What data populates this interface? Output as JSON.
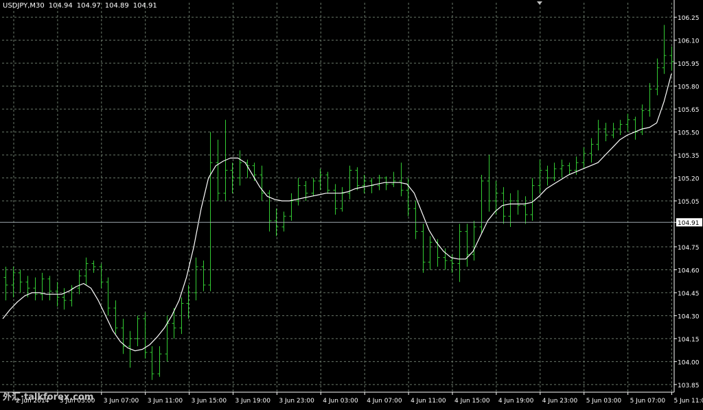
{
  "header": {
    "symbol": "USDJPY,M30",
    "open": "104.94",
    "high": "104.97",
    "low": "104.89",
    "close": "104.91"
  },
  "current_price_label": "104.91",
  "watermark": "外汇·talkforex.com",
  "colors": {
    "background": "#000000",
    "bars": "#33cc33",
    "ma_line": "#ffffff",
    "grid": "#6b7a6b",
    "axis_text": "#ffffff",
    "price_line": "#a0a8b0"
  },
  "chart_data": {
    "type": "line",
    "title": "USDJPY,M30",
    "xlabel": "",
    "ylabel": "",
    "ylim": [
      103.8,
      106.3
    ],
    "grid": true,
    "y_ticks": [
      "106.25",
      "106.10",
      "105.95",
      "105.80",
      "105.65",
      "105.50",
      "105.35",
      "105.20",
      "105.05",
      "104.91",
      "104.75",
      "104.60",
      "104.45",
      "104.30",
      "104.15",
      "104.00",
      "103.85"
    ],
    "x_tick_labels": [
      "2 Jun 2014",
      "3 Jun 03:00",
      "3 Jun 07:00",
      "3 Jun 11:00",
      "3 Jun 15:00",
      "3 Jun 19:00",
      "3 Jun 23:00",
      "4 Jun 03:00",
      "4 Jun 07:00",
      "4 Jun 11:00",
      "4 Jun 15:00",
      "4 Jun 19:00",
      "4 Jun 23:00",
      "5 Jun 03:00",
      "5 Jun 07:00",
      "5 Jun 11:00"
    ],
    "current_price": 104.91,
    "series": [
      {
        "kind": "ohlc",
        "values": [
          [
            104.55,
            104.62,
            104.4,
            104.5
          ],
          [
            104.5,
            104.62,
            104.42,
            104.58
          ],
          [
            104.58,
            104.6,
            104.45,
            104.52
          ],
          [
            104.52,
            104.56,
            104.42,
            104.48
          ],
          [
            104.48,
            104.55,
            104.4,
            104.44
          ],
          [
            104.44,
            104.58,
            104.4,
            104.54
          ],
          [
            104.54,
            104.56,
            104.4,
            104.46
          ],
          [
            104.46,
            104.52,
            104.36,
            104.42
          ],
          [
            104.42,
            104.48,
            104.34,
            104.4
          ],
          [
            104.4,
            104.5,
            104.36,
            104.48
          ],
          [
            104.48,
            104.6,
            104.44,
            104.56
          ],
          [
            104.56,
            104.68,
            104.5,
            104.64
          ],
          [
            104.64,
            104.66,
            104.58,
            104.62
          ],
          [
            104.62,
            104.64,
            104.48,
            104.52
          ],
          [
            104.52,
            104.55,
            104.3,
            104.35
          ],
          [
            104.35,
            104.4,
            104.18,
            104.22
          ],
          [
            104.22,
            104.28,
            104.05,
            104.1
          ],
          [
            104.1,
            104.2,
            103.96,
            104.15
          ],
          [
            104.15,
            104.3,
            104.1,
            104.28
          ],
          [
            104.28,
            104.32,
            104.02,
            104.06
          ],
          [
            104.06,
            104.1,
            103.88,
            103.92
          ],
          [
            103.92,
            104.1,
            103.9,
            104.05
          ],
          [
            104.05,
            104.3,
            104.0,
            104.25
          ],
          [
            104.25,
            104.35,
            104.15,
            104.22
          ],
          [
            104.22,
            104.42,
            104.18,
            104.38
          ],
          [
            104.38,
            104.5,
            104.28,
            104.45
          ],
          [
            104.45,
            104.68,
            104.4,
            104.62
          ],
          [
            104.62,
            104.66,
            104.46,
            104.5
          ],
          [
            104.5,
            105.5,
            104.46,
            105.3
          ],
          [
            105.3,
            105.45,
            105.05,
            105.1
          ],
          [
            105.1,
            105.58,
            105.05,
            105.25
          ],
          [
            105.25,
            105.3,
            105.1,
            105.2
          ],
          [
            105.2,
            105.38,
            105.15,
            105.3
          ],
          [
            105.3,
            105.32,
            105.2,
            105.28
          ],
          [
            105.28,
            105.3,
            105.18,
            105.22
          ],
          [
            105.22,
            105.28,
            105.05,
            105.1
          ],
          [
            105.1,
            105.12,
            104.85,
            104.92
          ],
          [
            104.92,
            105.0,
            104.82,
            104.88
          ],
          [
            104.88,
            104.98,
            104.85,
            104.95
          ],
          [
            104.95,
            105.1,
            104.92,
            105.05
          ],
          [
            105.05,
            105.2,
            105.02,
            105.15
          ],
          [
            105.15,
            105.18,
            105.05,
            105.1
          ],
          [
            105.1,
            105.2,
            105.08,
            105.18
          ],
          [
            105.18,
            105.26,
            105.12,
            105.22
          ],
          [
            105.22,
            105.24,
            105.1,
            105.12
          ],
          [
            105.12,
            105.16,
            104.96,
            105.0
          ],
          [
            105.0,
            105.14,
            104.98,
            105.1
          ],
          [
            105.1,
            105.28,
            105.06,
            105.25
          ],
          [
            105.25,
            105.27,
            105.12,
            105.15
          ],
          [
            105.15,
            105.22,
            105.1,
            105.18
          ],
          [
            105.18,
            105.2,
            105.1,
            105.15
          ],
          [
            105.15,
            105.22,
            105.12,
            105.2
          ],
          [
            105.2,
            105.21,
            105.12,
            105.16
          ],
          [
            105.16,
            105.24,
            105.14,
            105.18
          ],
          [
            105.18,
            105.3,
            105.08,
            105.12
          ],
          [
            105.12,
            105.2,
            104.95,
            105.0
          ],
          [
            105.0,
            105.05,
            104.8,
            104.85
          ],
          [
            104.85,
            104.9,
            104.58,
            104.65
          ],
          [
            104.65,
            104.82,
            104.6,
            104.78
          ],
          [
            104.78,
            104.8,
            104.62,
            104.68
          ],
          [
            104.68,
            104.74,
            104.6,
            104.66
          ],
          [
            104.66,
            104.7,
            104.58,
            104.64
          ],
          [
            104.64,
            104.9,
            104.52,
            104.85
          ],
          [
            104.85,
            104.9,
            104.62,
            104.7
          ],
          [
            104.7,
            104.92,
            104.66,
            104.88
          ],
          [
            104.88,
            105.22,
            104.84,
            105.18
          ],
          [
            105.18,
            105.35,
            104.98,
            105.05
          ],
          [
            105.05,
            105.18,
            104.96,
            105.1
          ],
          [
            105.1,
            105.14,
            104.9,
            104.95
          ],
          [
            104.95,
            105.1,
            104.88,
            105.05
          ],
          [
            105.05,
            105.12,
            104.96,
            105.02
          ],
          [
            105.02,
            105.08,
            104.9,
            104.96
          ],
          [
            104.96,
            105.2,
            104.92,
            105.15
          ],
          [
            105.15,
            105.32,
            105.1,
            105.25
          ],
          [
            105.25,
            105.28,
            105.15,
            105.2
          ],
          [
            105.2,
            105.3,
            105.18,
            105.26
          ],
          [
            105.26,
            105.32,
            105.2,
            105.28
          ],
          [
            105.28,
            105.3,
            105.22,
            105.25
          ],
          [
            105.25,
            105.34,
            105.22,
            105.3
          ],
          [
            105.3,
            105.4,
            105.26,
            105.36
          ],
          [
            105.36,
            105.46,
            105.3,
            105.42
          ],
          [
            105.42,
            105.58,
            105.38,
            105.52
          ],
          [
            105.52,
            105.56,
            105.44,
            105.48
          ],
          [
            105.48,
            105.56,
            105.46,
            105.52
          ],
          [
            105.52,
            105.58,
            105.48,
            105.55
          ],
          [
            105.55,
            105.62,
            105.5,
            105.58
          ],
          [
            105.58,
            105.6,
            105.45,
            105.5
          ],
          [
            105.5,
            105.68,
            105.48,
            105.64
          ],
          [
            105.64,
            105.82,
            105.6,
            105.78
          ],
          [
            105.78,
            105.98,
            105.74,
            105.92
          ],
          [
            105.92,
            106.2,
            105.88,
            106.0
          ],
          [
            106.0,
            106.06,
            105.9,
            105.96
          ]
        ]
      },
      {
        "name": "",
        "kind": "moving-average",
        "values": [
          104.28,
          104.34,
          104.39,
          104.43,
          104.45,
          104.45,
          104.44,
          104.44,
          104.44,
          104.46,
          104.49,
          104.51,
          104.48,
          104.4,
          104.3,
          104.2,
          104.13,
          104.09,
          104.07,
          104.08,
          104.11,
          104.16,
          104.22,
          104.3,
          104.4,
          104.55,
          104.75,
          105.0,
          105.2,
          105.28,
          105.31,
          105.33,
          105.33,
          105.3,
          105.22,
          105.14,
          105.08,
          105.06,
          105.05,
          105.05,
          105.06,
          105.07,
          105.08,
          105.09,
          105.1,
          105.1,
          105.1,
          105.11,
          105.13,
          105.14,
          105.15,
          105.16,
          105.17,
          105.17,
          105.17,
          105.16,
          105.1,
          104.98,
          104.86,
          104.78,
          104.72,
          104.68,
          104.67,
          104.67,
          104.72,
          104.82,
          104.92,
          104.98,
          105.02,
          105.03,
          105.03,
          105.03,
          105.04,
          105.08,
          105.13,
          105.16,
          105.19,
          105.22,
          105.24,
          105.26,
          105.28,
          105.3,
          105.35,
          105.4,
          105.45,
          105.48,
          105.5,
          105.52,
          105.53,
          105.56,
          105.7,
          105.88
        ]
      }
    ]
  }
}
